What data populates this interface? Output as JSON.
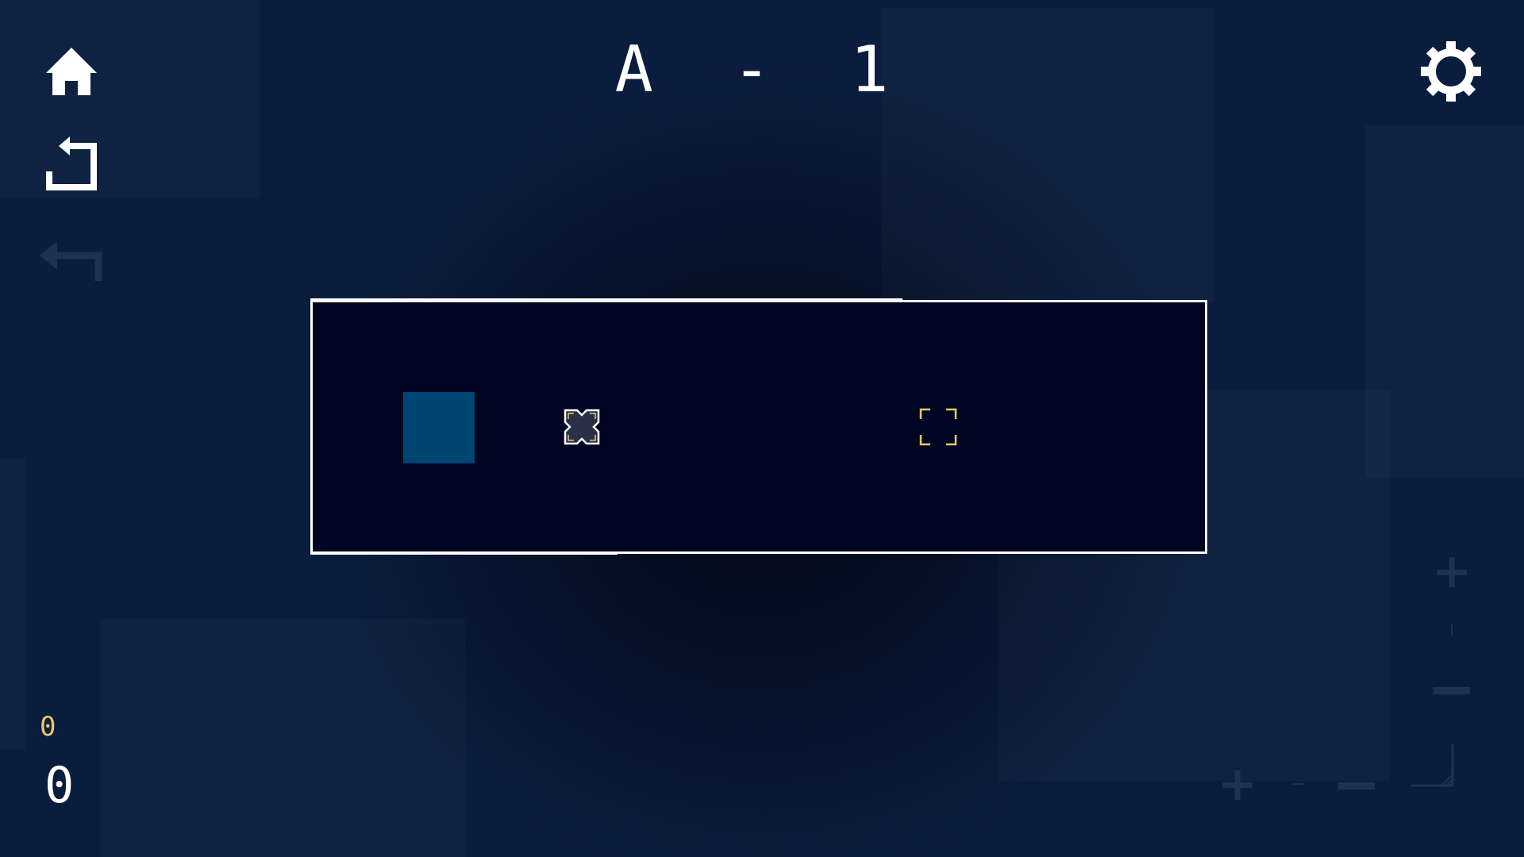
{
  "game": {
    "level_label": "A - 1",
    "counter_yellow": "0",
    "counter_white": "0"
  },
  "toolbar": {
    "home_icon": "home-icon",
    "restart_icon": "restart-icon",
    "undo_icon": "undo-icon",
    "settings_icon": "gear-icon"
  },
  "colors": {
    "background": "#0b1d3e",
    "board": "#000521",
    "player": "#004673",
    "accent_yellow": "#e8c868",
    "faded_ui": "#1e3152"
  }
}
